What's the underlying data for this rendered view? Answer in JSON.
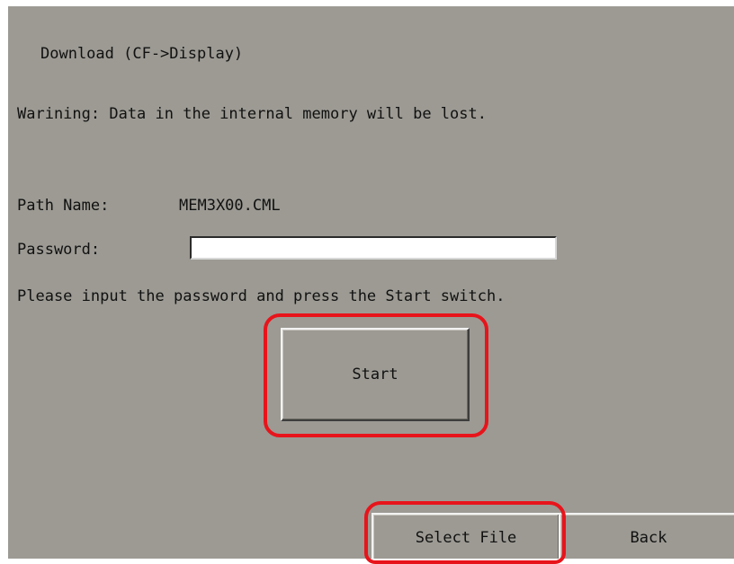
{
  "screen": {
    "title": "Download (CF->Display)",
    "warning": "Warining: Data in the internal memory will be lost.",
    "path_label": "Path Name:",
    "path_value": "MEM3X00.CML",
    "password_label": "Password:",
    "password_value": "",
    "instruction": "Please input the password and press the Start switch."
  },
  "buttons": {
    "start": "Start",
    "select_file": "Select File",
    "back": "Back"
  },
  "colors": {
    "background": "#9c9a93",
    "highlight": "#e8141b"
  }
}
